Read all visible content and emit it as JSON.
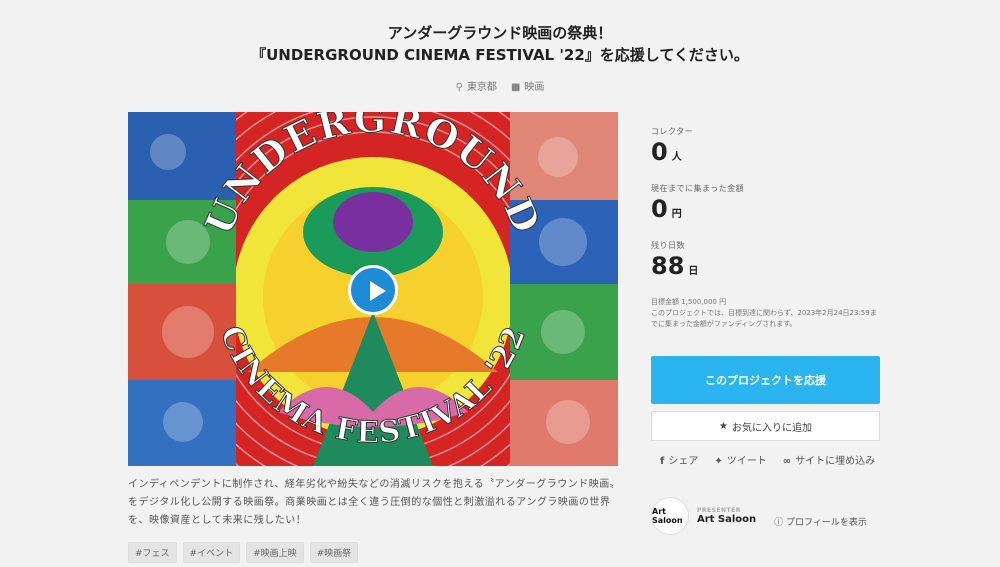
{
  "header": {
    "title_line1": "アンダーグラウンド映画の祭典！",
    "title_line2": "『UNDERGROUND CINEMA FESTIVAL '22』を応援してください。",
    "location": "東京都",
    "category": "映画"
  },
  "hero": {
    "logo_top": "UNDERGROUND",
    "logo_bottom": "CINEMA FESTIVAL '22"
  },
  "description": "インディペンデントに制作され、経年劣化や紛失などの消滅リスクを抱える〝アンダーグラウンド映画〟をデジタル化し公開する映画祭。商業映画とは全く違う圧倒的な個性と刺激溢れるアングラ映画の世界を、映像資産として未来に残したい！",
  "tags": [
    "#フェス",
    "#イベント",
    "#映画上映",
    "#映画祭"
  ],
  "stats": {
    "collector_label": "コレクター",
    "collector_value": "0",
    "collector_unit": "人",
    "raised_label": "現在までに集まった金額",
    "raised_value": "0",
    "raised_unit": "円",
    "days_label": "残り日数",
    "days_value": "88",
    "days_unit": "日",
    "goal": "目標金額 1,500,000 円",
    "note": "このプロジェクトでは、目標到達に関わらず、2023年2月24日23:59までに集まった金額がファンディングされます。"
  },
  "actions": {
    "support": "このプロジェクトを応援",
    "favorite": "お気に入りに追加",
    "share": "シェア",
    "tweet": "ツイート",
    "embed": "サイトに埋め込み"
  },
  "presenter": {
    "label": "PRESENTER",
    "name": "Art Saloon",
    "avatar_text": "Art Saloon",
    "profile": "プロフィールを表示"
  }
}
